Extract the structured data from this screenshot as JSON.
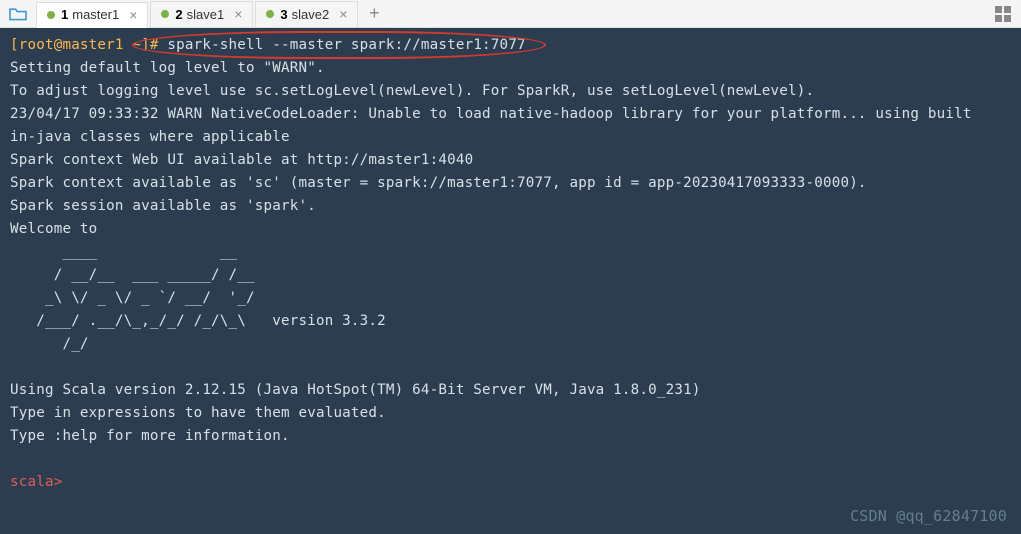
{
  "tabs": [
    {
      "num": "1",
      "label": "master1",
      "active": true
    },
    {
      "num": "2",
      "label": "slave1",
      "active": false
    },
    {
      "num": "3",
      "label": "slave2",
      "active": false
    }
  ],
  "terminal": {
    "prompt": "[root@master1 ~]# ",
    "command": "spark-shell --master spark://master1:7077",
    "lines": [
      "Setting default log level to \"WARN\".",
      "To adjust logging level use sc.setLogLevel(newLevel). For SparkR, use setLogLevel(newLevel).",
      "23/04/17 09:33:32 WARN NativeCodeLoader: Unable to load native-hadoop library for your platform... using built",
      "in-java classes where applicable",
      "Spark context Web UI available at http://master1:4040",
      "Spark context available as 'sc' (master = spark://master1:7077, app id = app-20230417093333-0000).",
      "Spark session available as 'spark'.",
      "Welcome to",
      "      ____              __",
      "     / __/__  ___ _____/ /__",
      "    _\\ \\/ _ \\/ _ `/ __/  '_/",
      "   /___/ .__/\\_,_/_/ /_/\\_\\   version 3.3.2",
      "      /_/",
      "",
      "Using Scala version 2.12.15 (Java HotSpot(TM) 64-Bit Server VM, Java 1.8.0_231)",
      "Type in expressions to have them evaluated.",
      "Type :help for more information.",
      ""
    ],
    "scala_prompt": "scala> "
  },
  "watermark": "CSDN @qq_62847100"
}
